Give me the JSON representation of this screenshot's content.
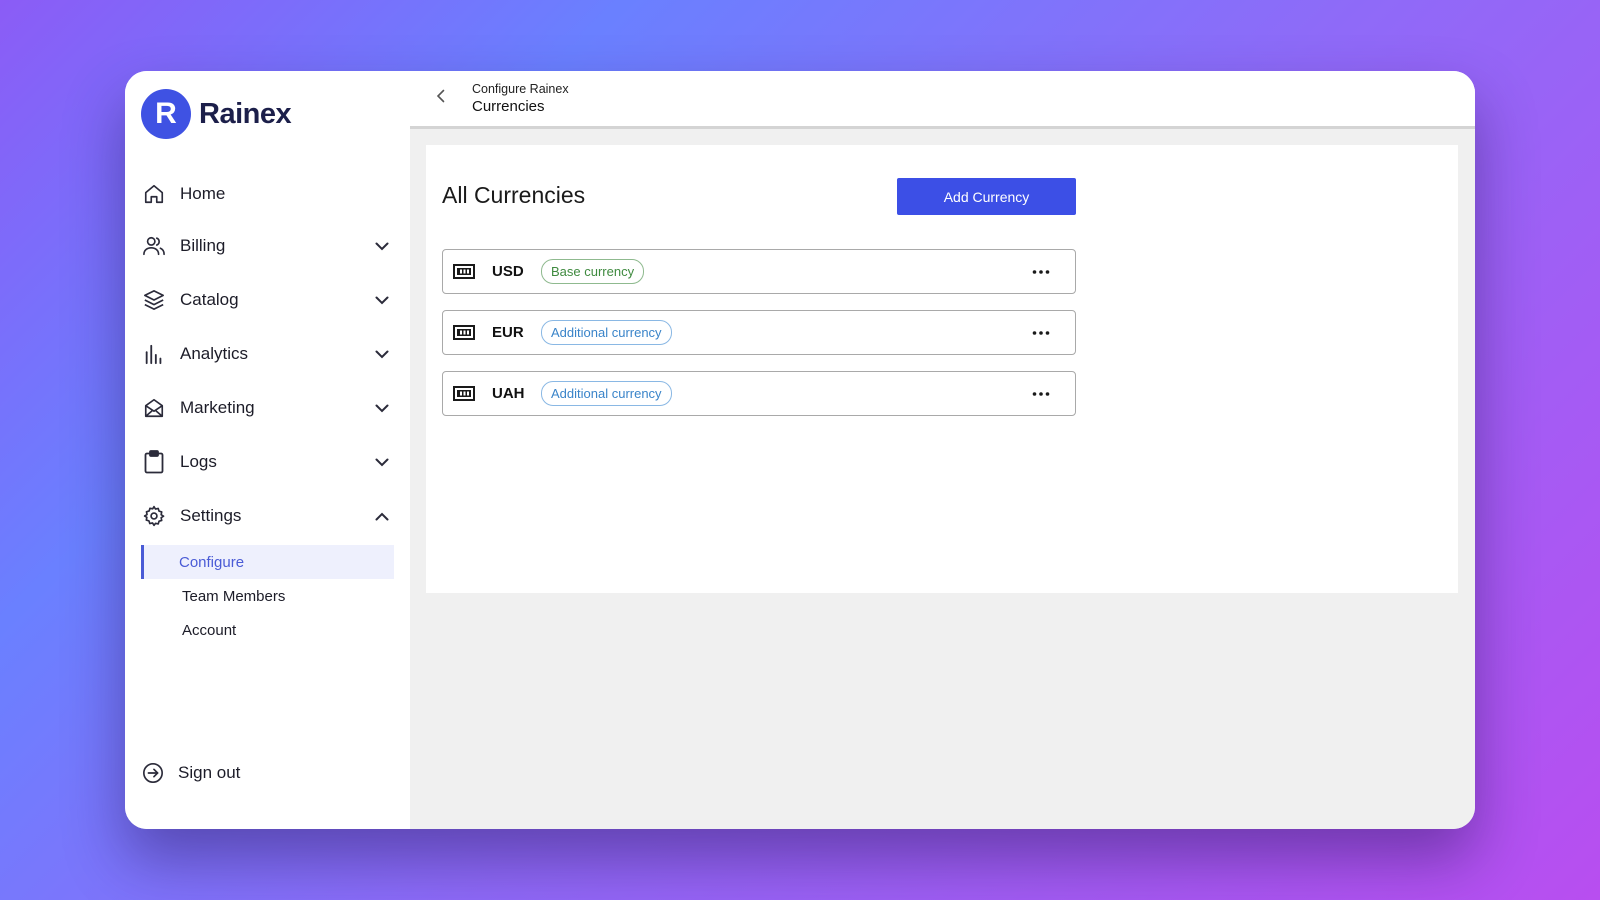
{
  "app": {
    "brand": "Rainex",
    "logo_letter": "R",
    "brand_color": "#3f52e3",
    "accent_color": "#3c4fe6"
  },
  "sidebar": {
    "items": [
      {
        "label": "Home",
        "icon": "home-icon",
        "expandable": false
      },
      {
        "label": "Billing",
        "icon": "users-icon",
        "expandable": true,
        "expanded": false
      },
      {
        "label": "Catalog",
        "icon": "layers-icon",
        "expandable": true,
        "expanded": false
      },
      {
        "label": "Analytics",
        "icon": "bar-chart-icon",
        "expandable": true,
        "expanded": false
      },
      {
        "label": "Marketing",
        "icon": "mail-icon",
        "expandable": true,
        "expanded": false
      },
      {
        "label": "Logs",
        "icon": "clipboard-icon",
        "expandable": true,
        "expanded": false
      },
      {
        "label": "Settings",
        "icon": "gear-icon",
        "expandable": true,
        "expanded": true
      }
    ],
    "settings_sub": [
      {
        "label": "Configure",
        "active": true
      },
      {
        "label": "Team Members",
        "active": false
      },
      {
        "label": "Account",
        "active": false
      }
    ],
    "signout_label": "Sign out"
  },
  "header": {
    "breadcrumb_parent": "Configure Rainex",
    "breadcrumb_current": "Currencies"
  },
  "main": {
    "title": "All Currencies",
    "add_button_label": "Add Currency",
    "currencies": [
      {
        "code": "USD",
        "badge": "Base currency",
        "badge_type": "base"
      },
      {
        "code": "EUR",
        "badge": "Additional currency",
        "badge_type": "additional"
      },
      {
        "code": "UAH",
        "badge": "Additional currency",
        "badge_type": "additional"
      }
    ]
  }
}
